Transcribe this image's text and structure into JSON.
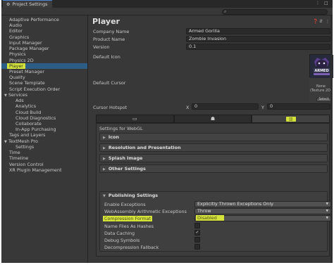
{
  "window": {
    "tab_title": "Project Settings",
    "search": {
      "placeholder": "",
      "value": ""
    }
  },
  "sidebar": {
    "items": [
      {
        "label": "Adaptive Performance",
        "indent": 0
      },
      {
        "label": "Audio",
        "indent": 0
      },
      {
        "label": "Editor",
        "indent": 0
      },
      {
        "label": "Graphics",
        "indent": 0
      },
      {
        "label": "Input Manager",
        "indent": 0
      },
      {
        "label": "Package Manager",
        "indent": 0
      },
      {
        "label": "Physics",
        "indent": 0
      },
      {
        "label": "Physics 2D",
        "indent": 0
      },
      {
        "label": "Player",
        "indent": 0,
        "selected": true
      },
      {
        "label": "Preset Manager",
        "indent": 0
      },
      {
        "label": "Quality",
        "indent": 0
      },
      {
        "label": "Scene Template",
        "indent": 0
      },
      {
        "label": "Script Execution Order",
        "indent": 0
      },
      {
        "label": "Services",
        "indent": 0,
        "expanded": true
      },
      {
        "label": "Ads",
        "indent": 1
      },
      {
        "label": "Analytics",
        "indent": 1
      },
      {
        "label": "Cloud Build",
        "indent": 1
      },
      {
        "label": "Cloud Diagnostics",
        "indent": 1
      },
      {
        "label": "Collaborate",
        "indent": 1
      },
      {
        "label": "In-App Purchasing",
        "indent": 1
      },
      {
        "label": "Tags and Layers",
        "indent": 0
      },
      {
        "label": "TextMesh Pro",
        "indent": 0,
        "expanded": true
      },
      {
        "label": "Settings",
        "indent": 1
      },
      {
        "label": "Time",
        "indent": 0
      },
      {
        "label": "Timeline",
        "indent": 0
      },
      {
        "label": "Version Control",
        "indent": 0
      },
      {
        "label": "XR Plugin Management",
        "indent": 0
      }
    ]
  },
  "main": {
    "title": "Player",
    "company_name": {
      "label": "Company Name",
      "value": "Armed Gorilla"
    },
    "product_name": {
      "label": "Product Name",
      "value": "Zombie Invasion"
    },
    "version": {
      "label": "Version",
      "value": "0.1"
    },
    "default_icon_label": "Default Icon",
    "default_cursor_label": "Default Cursor",
    "cursor_preview_line1": "None",
    "cursor_preview_line2": "(Texture 2D)",
    "select_label": "Select",
    "cursor_hotspot": {
      "label": "Cursor Hotspot",
      "x_label": "X",
      "x_value": "0",
      "y_label": "Y",
      "y_value": "0"
    },
    "icon_logo_text": "ARMED"
  },
  "platform_tabs": [
    {
      "icon": "monitor-icon",
      "glyph": "▭",
      "active": false
    },
    {
      "icon": "android-icon",
      "glyph": "☗",
      "active": false
    },
    {
      "icon": "webgl-icon",
      "glyph": "▥",
      "active": true
    }
  ],
  "settings": {
    "title": "Settings for WebGL",
    "sections": [
      "Icon",
      "Resolution and Presentation",
      "Splash Image",
      "Other Settings"
    ],
    "publishing": {
      "header": "Publishing Settings",
      "enable_exceptions": {
        "label": "Enable Exceptions",
        "value": "Explicitly Thrown Exceptions Only"
      },
      "wasm_exceptions": {
        "label": "WebAssembly Arithmetic Exceptions",
        "value": "Throw"
      },
      "compression_format": {
        "label": "Compression Format",
        "value": "Disabled"
      },
      "name_files_as_hashes": {
        "label": "Name Files As Hashes",
        "checked": false
      },
      "data_caching": {
        "label": "Data Caching",
        "checked": true,
        "glyph": "✓"
      },
      "debug_symbols": {
        "label": "Debug Symbols",
        "checked": false
      },
      "decompression_fallback": {
        "label": "Decompression Fallback",
        "checked": false
      }
    }
  },
  "colors": {
    "highlight": "#d4e33a",
    "selection": "#2c5d87",
    "panel": "#383838"
  }
}
